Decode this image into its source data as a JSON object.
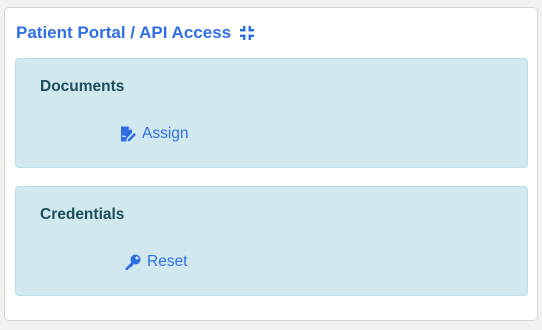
{
  "card": {
    "title": "Patient Portal / API Access",
    "collapse_icon": "compress-icon"
  },
  "sections": [
    {
      "title": "Documents",
      "action_label": "Assign",
      "action_icon": "file-signature-icon"
    },
    {
      "title": "Credentials",
      "action_label": "Reset",
      "action_icon": "key-icon"
    }
  ],
  "colors": {
    "accent": "#2f6fe4",
    "section_bg": "#d1e8ef",
    "section_title": "#1d4e5c"
  }
}
